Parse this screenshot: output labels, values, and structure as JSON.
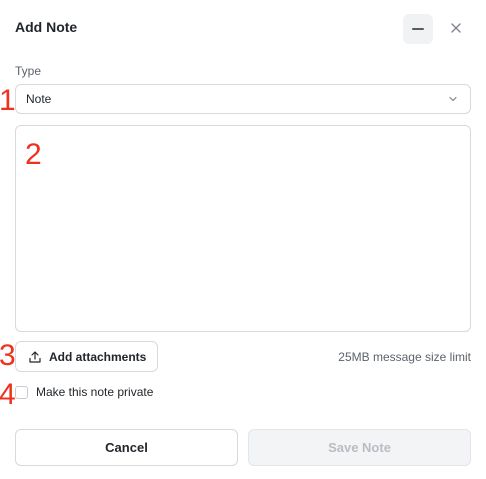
{
  "dialog": {
    "title": "Add Note",
    "minimize_icon": "minus-icon",
    "close_icon": "close-icon"
  },
  "type_field": {
    "label": "Type",
    "selected": "Note",
    "chevron_icon": "chevron-down-icon"
  },
  "note_body": {
    "value": ""
  },
  "attachments": {
    "button_label": "Add attachments",
    "icon": "upload-icon",
    "size_limit": "25MB message size limit"
  },
  "privacy": {
    "checkbox_label": "Make this note private",
    "checked": false
  },
  "actions": {
    "cancel_label": "Cancel",
    "save_label": "Save Note",
    "save_enabled": false
  },
  "annotations": {
    "markers": [
      "1",
      "2",
      "3",
      "4"
    ],
    "color": "#f0311e"
  }
}
